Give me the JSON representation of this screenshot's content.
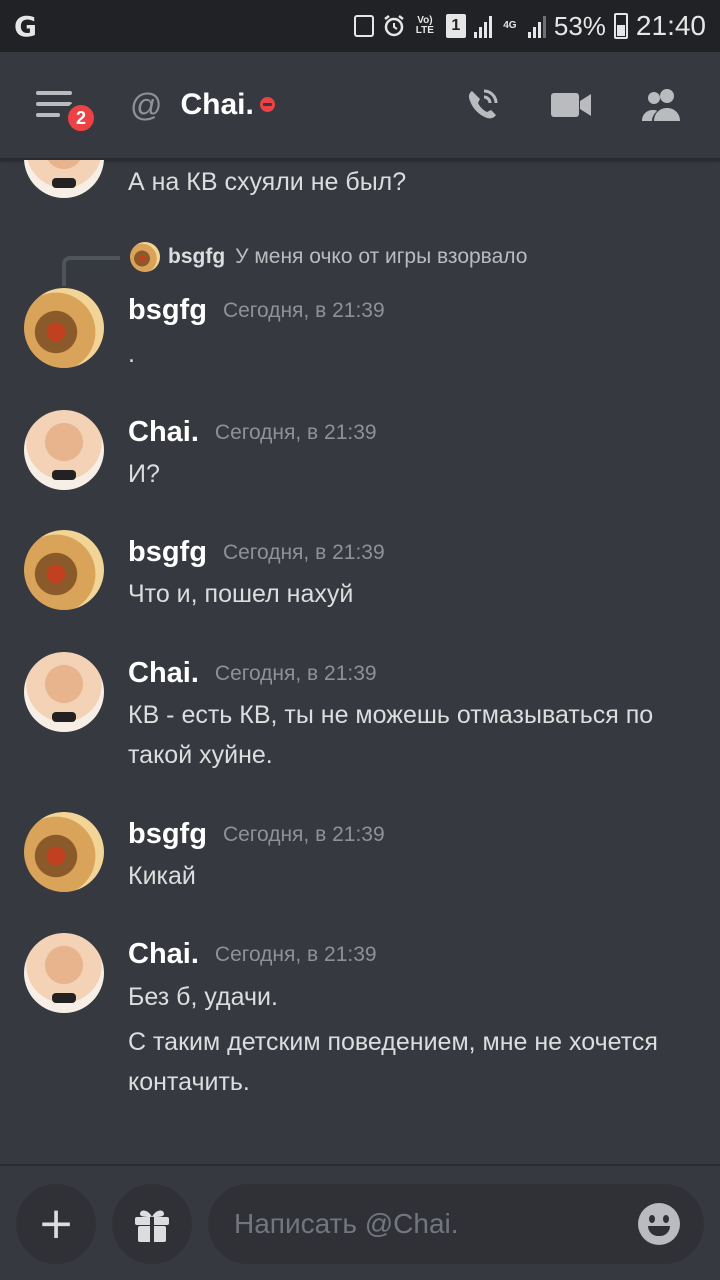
{
  "status_bar": {
    "google_logo": "G",
    "volte_label": "Vo) LTE",
    "sim_label": "1",
    "network_label": "4G",
    "battery_percent": "53%",
    "time": "21:40"
  },
  "header": {
    "badge_count": "2",
    "at_symbol": "@",
    "channel_name": "Chai.",
    "presence": "dnd",
    "accent": "#ed4245"
  },
  "messages": {
    "partial": {
      "text": "А на КВ схуяли не был?"
    },
    "reply": {
      "author": "bsgfg",
      "text": "У меня очко от игры взорвало"
    },
    "groups": [
      {
        "author": "bsgfg",
        "timestamp": "Сегодня, в 21:39",
        "lines": [
          "."
        ]
      },
      {
        "author": "Chai.",
        "timestamp": "Сегодня, в 21:39",
        "lines": [
          "И?"
        ]
      },
      {
        "author": "bsgfg",
        "timestamp": "Сегодня, в 21:39",
        "lines": [
          "Что и, пошел нахуй"
        ]
      },
      {
        "author": "Chai.",
        "timestamp": "Сегодня, в 21:39",
        "lines": [
          "КВ - есть КВ, ты не можешь отмазываться по такой хуйне."
        ]
      },
      {
        "author": "bsgfg",
        "timestamp": "Сегодня, в 21:39",
        "lines": [
          "Кикай"
        ]
      },
      {
        "author": "Chai.",
        "timestamp": "Сегодня, в 21:39",
        "lines": [
          "Без б, удачи.",
          "С таким детским поведением, мне не хочется контачить."
        ]
      }
    ]
  },
  "composer": {
    "add_symbol": "+",
    "placeholder": "Написать @Chai."
  },
  "icons": {
    "menu": "hamburger-menu-icon",
    "call": "phone-call-icon",
    "video": "video-camera-icon",
    "members": "members-icon",
    "gift": "gift-icon",
    "emoji": "emoji-smile-icon"
  },
  "colors": {
    "background": "#36393f",
    "status_bar": "#202225",
    "input": "#2f3136",
    "badge": "#ed4245"
  }
}
